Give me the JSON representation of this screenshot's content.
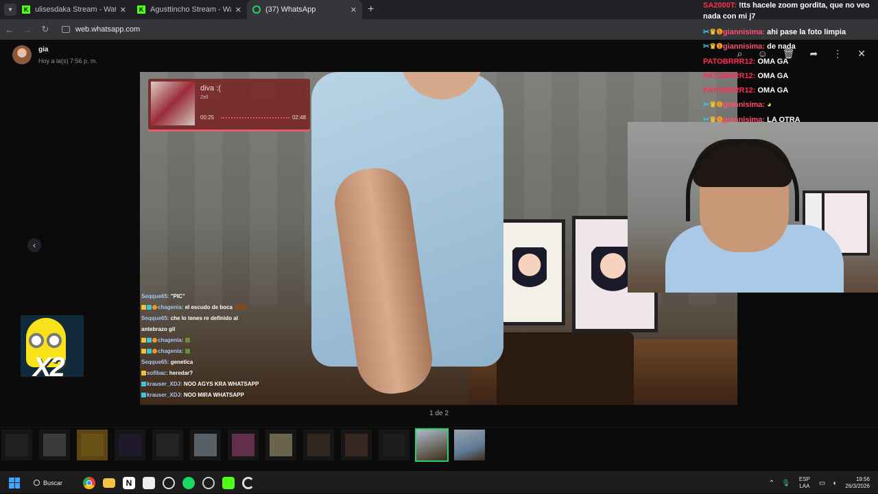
{
  "browser": {
    "tabs": [
      {
        "title": "ulisesdaka Stream - Watch Live",
        "favicon": "kick-icon",
        "active": false
      },
      {
        "title": "Agusttincho Stream - Watch Liv",
        "favicon": "kick-icon",
        "active": false
      },
      {
        "title": "(37) WhatsApp",
        "favicon": "whatsapp-icon",
        "active": true
      }
    ],
    "new_tab_label": "+",
    "url": "web.whatsapp.com"
  },
  "viewer": {
    "sender_name": "gia",
    "sender_time": "Hoy a la(s) 7:56 p. m.",
    "counter": "1 de 2",
    "selected_thumb_index": 11
  },
  "now_playing": {
    "title": "diva :(",
    "artist": "Zell",
    "current": "00:25",
    "total": "02:48"
  },
  "stream_chat": [
    {
      "user": "Seqque65:",
      "text": "\"PIC\""
    },
    {
      "user": "chagenia:",
      "text": "el escudo de boca"
    },
    {
      "user": "Seqque65:",
      "text": "che lo tenes re definido al"
    },
    {
      "user": "",
      "text": "antebrazo gil"
    },
    {
      "user": "chagenia:",
      "text": ""
    },
    {
      "user": "chagenia:",
      "text": ""
    },
    {
      "user": "Seqque65:",
      "text": "genetica"
    },
    {
      "user": "sofibac:",
      "text": "heredar?"
    },
    {
      "user": "krauser_XDJ:",
      "text": "NOO AGYS KRA WHATSAPP"
    },
    {
      "user": "krauser_XDJ:",
      "text": "NOO MIRA WHATSAPP"
    }
  ],
  "overlay_chat": {
    "first_line_user": "SA2000T:",
    "first_line_text": "!tts hacele zoom gordita, que no veo nada con mi j7",
    "messages": [
      {
        "user": "giannisima:",
        "text": "ahi pase la foto limpia"
      },
      {
        "user": "giannisima:",
        "text": "de nada"
      },
      {
        "user": "PATOBRRR12:",
        "text": "OMA GA"
      },
      {
        "user": "PATOBRRR12:",
        "text": "OMA GA"
      },
      {
        "user": "PATOBRRR12:",
        "text": "OMA GA"
      },
      {
        "user": "giannisima:",
        "text": ""
      },
      {
        "user": "giannisima:",
        "text": "LA OTRA"
      }
    ]
  },
  "sticker": {
    "text": "X2"
  },
  "taskbar": {
    "search_label": "Buscar",
    "lang_top": "ESP",
    "lang_bottom": "LAA",
    "time": "19:56",
    "date": "26/3/2026"
  },
  "colors": {
    "whatsapp_green": "#25d366",
    "kick_green": "#53fc18",
    "chat_red": "#ff2d55"
  }
}
